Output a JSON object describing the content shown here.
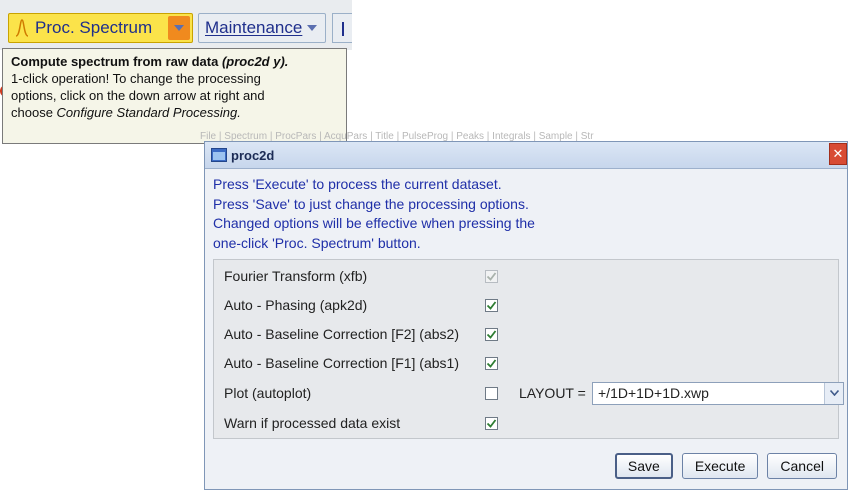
{
  "toolbar": {
    "proc_label": "Proc. Spectrum",
    "maintenance_label": "Maintenance"
  },
  "tooltip": {
    "line1": "Compute spectrum from raw data",
    "line1_em": "(proc2d y).",
    "line2": "1-click operation! To change the processing",
    "line3": "options, click on the down arrow at right and",
    "line4_prefix": "choose",
    "line4_em": "Configure Standard Processing."
  },
  "ribbon_text": "File | Spectrum | ProcPars | AcquPars | Title | PulseProg | Peaks | Integrals | Sample | Str",
  "dialog": {
    "title": "proc2d",
    "close_glyph": "✕",
    "info_lines": [
      "Press 'Execute' to process the current dataset.",
      "Press 'Save' to just change the processing options.",
      "Changed options will be effective when pressing the",
      "one-click 'Proc. Spectrum' button."
    ],
    "options": [
      {
        "label": "Fourier Transform (xfb)",
        "checked": true,
        "disabled": true
      },
      {
        "label": "Auto - Phasing (apk2d)",
        "checked": true,
        "disabled": false
      },
      {
        "label": "Auto - Baseline Correction [F2] (abs2)",
        "checked": true,
        "disabled": false
      },
      {
        "label": "Auto - Baseline Correction [F1] (abs1)",
        "checked": true,
        "disabled": false
      },
      {
        "label": "Plot (autoplot)",
        "checked": false,
        "disabled": false
      },
      {
        "label": "Warn if processed data exist",
        "checked": true,
        "disabled": false
      }
    ],
    "layout_label": "LAYOUT =",
    "layout_value": "+/1D+1D+1D.xwp",
    "buttons": {
      "save": "Save",
      "execute": "Execute",
      "cancel": "Cancel"
    }
  },
  "colors": {
    "accent_yellow": "#fbe34a",
    "arrow_orange": "#f08a1e",
    "info_text_blue": "#1f2fa8",
    "check_green": "#2e7d32",
    "close_red": "#d84b34"
  }
}
